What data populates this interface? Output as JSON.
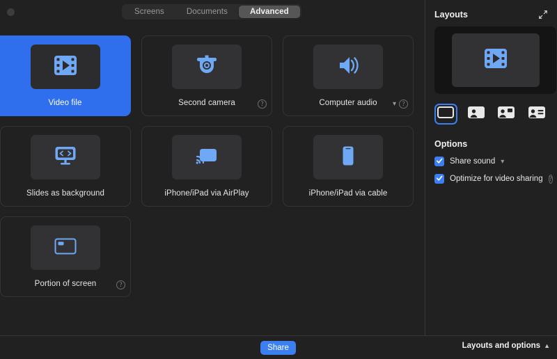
{
  "window": {
    "close_button": "close-button"
  },
  "tabs": [
    {
      "label": "Screens",
      "active": false
    },
    {
      "label": "Documents",
      "active": false
    },
    {
      "label": "Advanced",
      "active": true
    }
  ],
  "share_sources": [
    {
      "label": "Video file",
      "icon": "film-icon",
      "selected": true,
      "help": false,
      "chevron": false
    },
    {
      "label": "Second camera",
      "icon": "dome-camera-icon",
      "selected": false,
      "help": true,
      "chevron": false
    },
    {
      "label": "Computer audio",
      "icon": "speaker-icon",
      "selected": false,
      "help": true,
      "chevron": true
    },
    {
      "label": "Slides as background",
      "icon": "code-monitor-icon",
      "selected": false,
      "help": false,
      "chevron": false
    },
    {
      "label": "iPhone/iPad via AirPlay",
      "icon": "airplay-icon",
      "selected": false,
      "help": false,
      "chevron": false
    },
    {
      "label": "iPhone/iPad via cable",
      "icon": "phone-icon",
      "selected": false,
      "help": false,
      "chevron": false
    },
    {
      "label": "Portion of screen",
      "icon": "crop-region-icon",
      "selected": false,
      "help": true,
      "chevron": false
    }
  ],
  "sidebar": {
    "layouts_title": "Layouts",
    "expand_icon": "expand-diagonal-icon",
    "preview_icon": "film-icon",
    "layout_buttons": [
      {
        "name": "layout-full-screen",
        "icon": "screen-only-icon",
        "active": true
      },
      {
        "name": "layout-speaker",
        "icon": "speaker-frame-icon",
        "active": false
      },
      {
        "name": "layout-picture-in-pic",
        "icon": "picture-in-picture-icon",
        "active": false
      },
      {
        "name": "layout-side-by-side",
        "icon": "side-by-side-icon",
        "active": false
      }
    ],
    "options_title": "Options",
    "options": [
      {
        "label": "Share sound",
        "checked": true,
        "chevron": true,
        "help": false
      },
      {
        "label": "Optimize for video sharing",
        "checked": true,
        "chevron": false,
        "help": true
      }
    ]
  },
  "bottom": {
    "share_label": "Share",
    "layouts_options_label": "Layouts and options",
    "chevron": "chevron-up-icon"
  },
  "colors": {
    "accent": "#3b7ff0",
    "selected_card": "#2f6fed",
    "background": "#212121",
    "thumb": "#323234",
    "icon_blue": "#6fa8f5"
  }
}
